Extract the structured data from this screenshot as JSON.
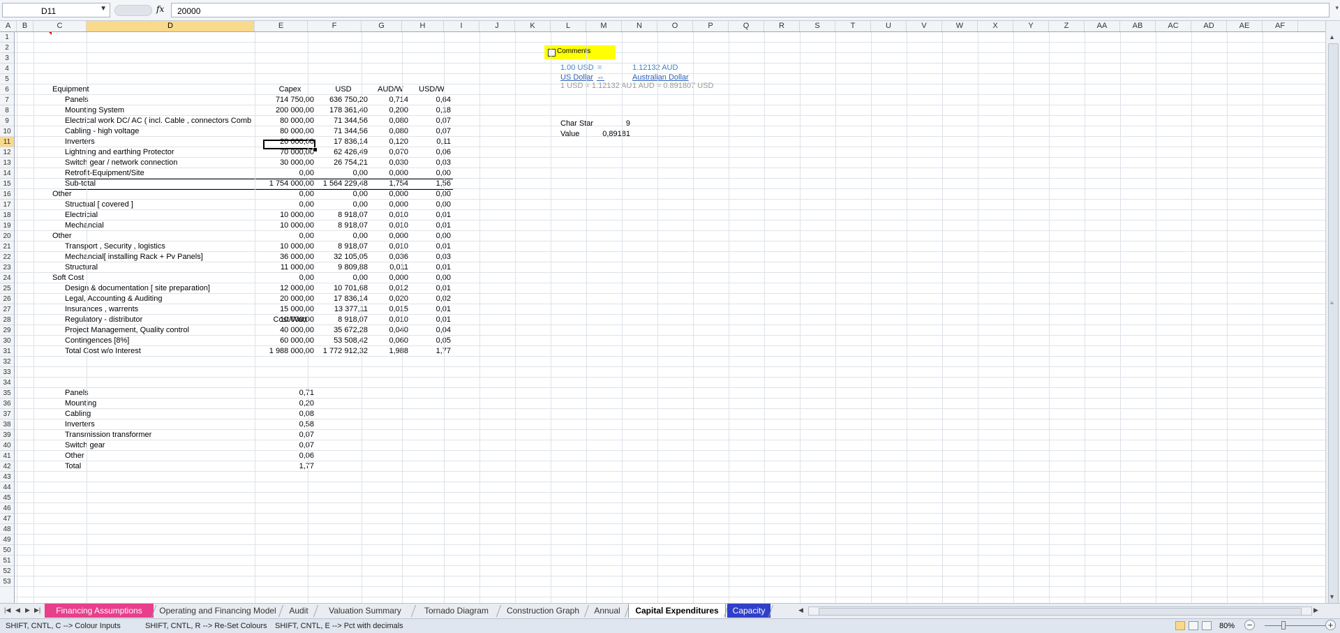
{
  "formula_bar": {
    "name_box": "D11",
    "formula": "20000",
    "fx_label": "fx"
  },
  "columns": [
    "A",
    "B",
    "C",
    "D",
    "E",
    "F",
    "G",
    "H",
    "I",
    "J",
    "K",
    "L",
    "M",
    "N",
    "O",
    "P",
    "Q",
    "R",
    "S",
    "T",
    "U",
    "V",
    "W",
    "X",
    "Y",
    "Z",
    "AA",
    "AB",
    "AC",
    "AD",
    "AE",
    "AF"
  ],
  "active_column": "D",
  "active_row": 11,
  "rows": [
    1,
    2,
    3,
    4,
    5,
    6,
    7,
    8,
    9,
    10,
    11,
    12,
    13,
    14,
    15,
    16,
    17,
    18,
    19,
    20,
    21,
    22,
    23,
    24,
    25,
    26,
    27,
    28,
    29,
    30,
    31,
    32,
    33,
    34,
    35,
    36,
    37,
    38,
    39,
    40,
    41,
    42,
    43,
    44,
    45,
    46,
    47,
    48,
    49,
    50,
    51,
    52,
    53
  ],
  "comments_box": {
    "label": "Comments",
    "checked": false
  },
  "main_table": {
    "headers": {
      "item": "Equipment",
      "capex": "Capex",
      "usd": "USD",
      "aud_w": "AUD/W",
      "usd_w": "USD/W"
    },
    "rows": [
      {
        "row": 7,
        "label": "Panels",
        "indent": true,
        "capex": "714 750,00",
        "usd": "636 750,20",
        "aud_w": "0,714",
        "usd_w": "0,64"
      },
      {
        "row": 8,
        "label": "Mounting System",
        "indent": true,
        "capex": "200 000,00",
        "usd": "178 361,40",
        "aud_w": "0,200",
        "usd_w": "0,18"
      },
      {
        "row": 9,
        "label": "Electrical work DC/ AC ( incl. Cable , connectors Comb",
        "indent": true,
        "capex": "80 000,00",
        "usd": "71 344,56",
        "aud_w": "0,080",
        "usd_w": "0,07"
      },
      {
        "row": 10,
        "label": "Cabling - high voltage",
        "indent": true,
        "capex": "80 000,00",
        "usd": "71 344,56",
        "aud_w": "0,080",
        "usd_w": "0,07"
      },
      {
        "row": 11,
        "label": "Inverters",
        "indent": true,
        "capex": "20 000,00",
        "usd": "17 836,14",
        "aud_w": "0,120",
        "usd_w": "0,11"
      },
      {
        "row": 12,
        "label": "Lightning and earthing Protector",
        "indent": true,
        "capex": "70 000,00",
        "usd": "62 426,49",
        "aud_w": "0,070",
        "usd_w": "0,06"
      },
      {
        "row": 13,
        "label": "Switch gear / network connection",
        "indent": true,
        "capex": "30 000,00",
        "usd": "26 754,21",
        "aud_w": "0,030",
        "usd_w": "0,03"
      },
      {
        "row": 14,
        "label": "Retrofit-Equipment/Site",
        "indent": true,
        "capex": "0,00",
        "usd": "0,00",
        "aud_w": "0,000",
        "usd_w": "0,00"
      },
      {
        "row": 15,
        "label": "Sub-total",
        "indent": true,
        "capex": "1 754 000,00",
        "usd": "1 564 229,48",
        "aud_w": "1,754",
        "usd_w": "1,56"
      },
      {
        "row": 16,
        "label": "Other",
        "indent": false,
        "capex": "0,00",
        "usd": "0,00",
        "aud_w": "0,000",
        "usd_w": "0,00"
      },
      {
        "row": 17,
        "label": "Structual [ covered ]",
        "indent": true,
        "capex": "0,00",
        "usd": "0,00",
        "aud_w": "0,000",
        "usd_w": "0,00"
      },
      {
        "row": 18,
        "label": "Electricial",
        "indent": true,
        "capex": "10 000,00",
        "usd": "8 918,07",
        "aud_w": "0,010",
        "usd_w": "0,01"
      },
      {
        "row": 19,
        "label": "Mechancial",
        "indent": true,
        "capex": "10 000,00",
        "usd": "8 918,07",
        "aud_w": "0,010",
        "usd_w": "0,01"
      },
      {
        "row": 20,
        "label": "Other",
        "indent": false,
        "capex": "0,00",
        "usd": "0,00",
        "aud_w": "0,000",
        "usd_w": "0,00"
      },
      {
        "row": 21,
        "label": "Transport , Security , logistics",
        "indent": true,
        "capex": "10 000,00",
        "usd": "8 918,07",
        "aud_w": "0,010",
        "usd_w": "0,01"
      },
      {
        "row": 22,
        "label": "Mechancial[ installing Rack + Pv Panels]",
        "indent": true,
        "capex": "36 000,00",
        "usd": "32 105,05",
        "aud_w": "0,036",
        "usd_w": "0,03"
      },
      {
        "row": 23,
        "label": "Structural",
        "indent": true,
        "capex": "11 000,00",
        "usd": "9 809,88",
        "aud_w": "0,011",
        "usd_w": "0,01"
      },
      {
        "row": 24,
        "label": "Soft Cost",
        "indent": false,
        "capex": "0,00",
        "usd": "0,00",
        "aud_w": "0,000",
        "usd_w": "0,00"
      },
      {
        "row": 25,
        "label": "Design & documentation [ site preparation]",
        "indent": true,
        "capex": "12 000,00",
        "usd": "10 701,68",
        "aud_w": "0,012",
        "usd_w": "0,01"
      },
      {
        "row": 26,
        "label": "Legal, Accounting & Auditing",
        "indent": true,
        "capex": "20 000,00",
        "usd": "17 836,14",
        "aud_w": "0,020",
        "usd_w": "0,02"
      },
      {
        "row": 27,
        "label": "Insurances , warrents",
        "indent": true,
        "capex": "15 000,00",
        "usd": "13 377,11",
        "aud_w": "0,015",
        "usd_w": "0,01"
      },
      {
        "row": 28,
        "label": "Regulatory - distributor",
        "indent": true,
        "capex": "10 000,00",
        "usd": "8 918,07",
        "aud_w": "0,010",
        "usd_w": "0,01"
      },
      {
        "row": 29,
        "label": "Project Management, Quality control",
        "indent": true,
        "capex": "40 000,00",
        "usd": "35 672,28",
        "aud_w": "0,040",
        "usd_w": "0,04"
      },
      {
        "row": 30,
        "label": "Contingences [8%]",
        "indent": true,
        "capex": "60 000,00",
        "usd": "53 508,42",
        "aud_w": "0,060",
        "usd_w": "0,05"
      },
      {
        "row": 31,
        "label": "Total Cost w/o Interest",
        "indent": true,
        "capex": "1 988 000,00",
        "usd": "1 772 912,32",
        "aud_w": "1,988",
        "usd_w": "1,77"
      }
    ]
  },
  "cost_table": {
    "header": "Cost/Watt",
    "rows": [
      {
        "row": 35,
        "label": "Panels",
        "value": "0,71"
      },
      {
        "row": 36,
        "label": "Mounting",
        "value": "0,20"
      },
      {
        "row": 37,
        "label": "Cabling",
        "value": "0,08"
      },
      {
        "row": 38,
        "label": "Inverters",
        "value": "0,58"
      },
      {
        "row": 39,
        "label": "Transmission transformer",
        "value": "0,07"
      },
      {
        "row": 40,
        "label": "Switch gear",
        "value": "0,07"
      },
      {
        "row": 41,
        "label": "Other",
        "value": "0,06"
      },
      {
        "row": 42,
        "label": "Total",
        "value": "1,77"
      }
    ]
  },
  "currency": {
    "left_amount": "1.00 USD",
    "equals": "=",
    "right_amount": "1.12132 AUD",
    "left_link": "US Dollar",
    "swap": "⇔",
    "right_link": "Australian Dollar",
    "left_rate": "1 USD = 1.12132 AU",
    "right_rate": "1 AUD = 0.891807 USD",
    "char_star_label": "Char Star",
    "char_star_value": "9",
    "value_label": "Value",
    "value_value": "0,89181"
  },
  "sheet_tabs": [
    {
      "label": "Financing Assumptions",
      "style": "pink"
    },
    {
      "label": "Operating and Financing Model",
      "style": "normal"
    },
    {
      "label": "Audit",
      "style": "normal"
    },
    {
      "label": "Valuation Summary",
      "style": "normal"
    },
    {
      "label": "Tornado Diagram",
      "style": "normal"
    },
    {
      "label": "Construction Graph",
      "style": "normal"
    },
    {
      "label": "Annual",
      "style": "normal"
    },
    {
      "label": "Capital Expenditures",
      "style": "active"
    },
    {
      "label": "Capacity",
      "style": "blue"
    }
  ],
  "status_bar": {
    "hint1": "SHIFT, CNTL, C --> Colour Inputs",
    "hint2": "SHIFT, CNTL, R --> Re-Set Colours",
    "hint3": "SHIFT, CNTL, E --> Pct with decimals",
    "zoom": "80%",
    "zoom_fraction": 0.27
  }
}
